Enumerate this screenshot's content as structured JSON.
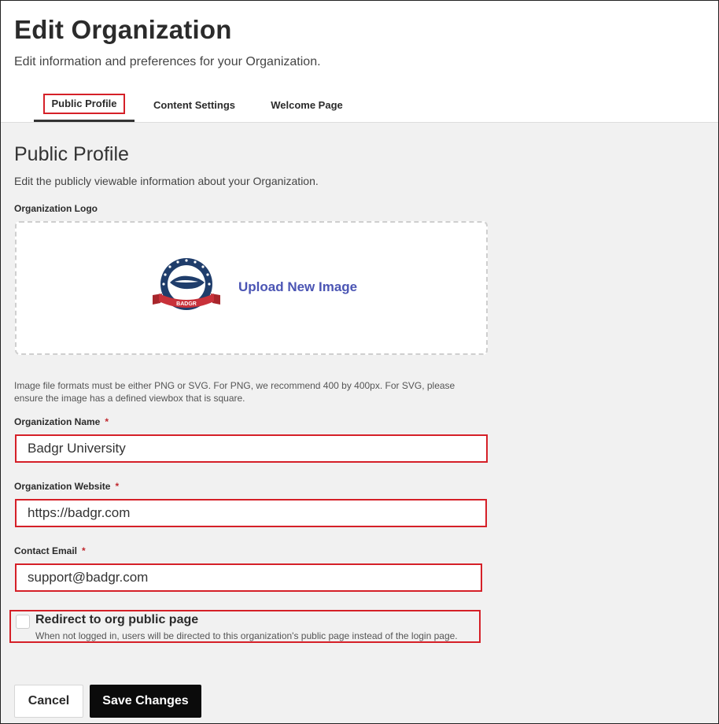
{
  "header": {
    "title": "Edit Organization",
    "subtitle": "Edit information and preferences for your Organization."
  },
  "tabs": [
    {
      "label": "Public Profile",
      "active": true
    },
    {
      "label": "Content Settings",
      "active": false
    },
    {
      "label": "Welcome Page",
      "active": false
    }
  ],
  "public_profile": {
    "title": "Public Profile",
    "description": "Edit the publicly viewable information about your Organization.",
    "logo": {
      "label": "Organization Logo",
      "upload_link": "Upload New Image",
      "logo_text": "BADGR",
      "help_text": "Image file formats must be either PNG or SVG. For PNG, we recommend 400 by 400px. For SVG, please ensure the image has a defined viewbox that is square."
    },
    "org_name": {
      "label": "Organization Name",
      "required_mark": "*",
      "value": "Badgr University"
    },
    "org_website": {
      "label": "Organization Website",
      "required_mark": "*",
      "value": "https://badgr.com"
    },
    "contact_email": {
      "label": "Contact Email",
      "required_mark": "*",
      "value": "support@badgr.com"
    },
    "redirect": {
      "label": "Redirect to org public page",
      "help": "When not logged in, users will be directed to this organization's public page instead of the login page.",
      "checked": false
    }
  },
  "actions": {
    "cancel_label": "Cancel",
    "save_label": "Save Changes"
  },
  "colors": {
    "accent_link": "#4b55b4",
    "highlight_border": "#d52028",
    "primary_button": "#0b0b0b",
    "content_background": "#f1f1f1"
  }
}
